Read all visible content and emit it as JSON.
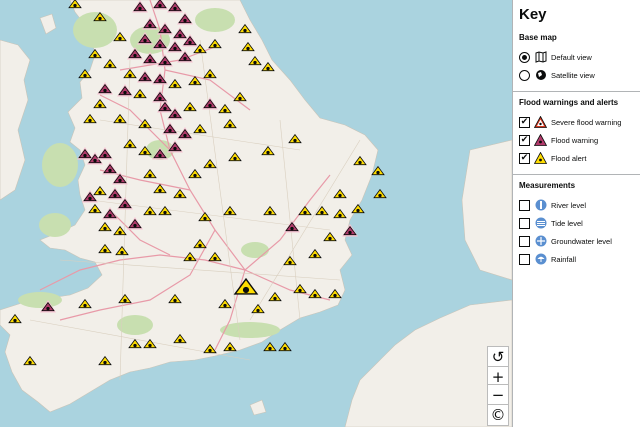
{
  "map": {
    "controls": {
      "reset_symbol": "↺",
      "zoom_in_symbol": "+",
      "zoom_out_symbol": "−",
      "copyright_symbol": "©"
    },
    "colors": {
      "sea": "#aad3df",
      "land": "#f2efe9",
      "green": "#c8dfb0",
      "road": "#e89aa8",
      "alert_fill": "#ffdd00",
      "severe_fill": "#d4351c",
      "warning_fill": "#b23a6b"
    },
    "markers_note_icon_names": [
      "flood-alert-icon",
      "flood-warning-icon",
      "severe-flood-warning-icon"
    ]
  },
  "key": {
    "title": "Key",
    "base_map": {
      "title": "Base map",
      "options": [
        {
          "label": "Default view",
          "selected": true,
          "icon": "map-icon"
        },
        {
          "label": "Satellite view",
          "selected": false,
          "icon": "globe-icon"
        }
      ]
    },
    "flood": {
      "title": "Flood warnings and alerts",
      "items": [
        {
          "label": "Severe flood warning",
          "checked": true,
          "icon": "severe-flood-warning-icon"
        },
        {
          "label": "Flood warning",
          "checked": true,
          "icon": "flood-warning-icon"
        },
        {
          "label": "Flood alert",
          "checked": true,
          "icon": "flood-alert-icon"
        }
      ]
    },
    "measurements": {
      "title": "Measurements",
      "items": [
        {
          "label": "River level",
          "checked": false,
          "icon": "river-level-icon"
        },
        {
          "label": "Tide level",
          "checked": false,
          "icon": "tide-level-icon"
        },
        {
          "label": "Groundwater level",
          "checked": false,
          "icon": "groundwater-level-icon"
        },
        {
          "label": "Rainfall",
          "checked": false,
          "icon": "rainfall-icon"
        }
      ]
    },
    "check_symbol": "✔"
  }
}
